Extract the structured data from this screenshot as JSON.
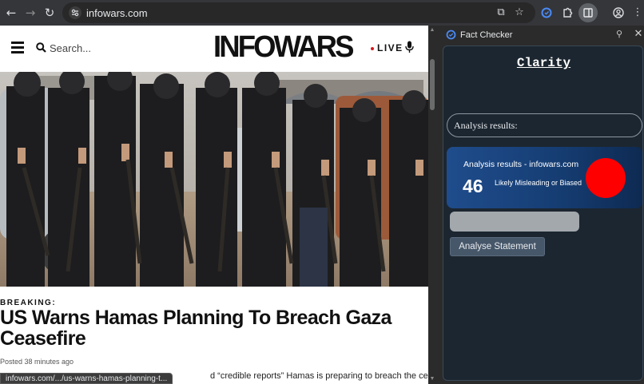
{
  "browser": {
    "url": "infowars.com",
    "status_url": "infowars.com/.../us-warns-hamas-planning-t..."
  },
  "site": {
    "logo_text": "INFOWARS",
    "search_placeholder": "Search...",
    "live_label": "LIVE",
    "brand_color": "#d8181f"
  },
  "article": {
    "kicker": "BREAKING:",
    "headline": "US Warns Hamas Planning To Breach Gaza Ceasefire",
    "posted": "Posted 38 minutes ago",
    "body_snippet": "d “credible reports” Hamas is preparing to breach the ceasefire in Gaza by making"
  },
  "side_panel": {
    "title": "Fact Checker",
    "app_name": "Clarity",
    "results_label": "Analysis results:",
    "result": {
      "title": "Analysis results - infowars.com",
      "score": "46",
      "verdict": "Likely Misleading or Biased",
      "indicator_color": "#ff0000"
    },
    "statement_value": "",
    "analyse_button": "Analyse Statement"
  },
  "icons": [
    "back-arrow-icon",
    "forward-arrow-icon",
    "reload-icon",
    "site-info-icon",
    "install-app-icon",
    "bookmark-star-icon",
    "extension-icon",
    "puzzle-icon",
    "side-panel-icon",
    "profile-icon",
    "more-menu-icon",
    "hamburger-icon",
    "search-icon",
    "mic-icon",
    "pin-icon",
    "close-icon"
  ]
}
